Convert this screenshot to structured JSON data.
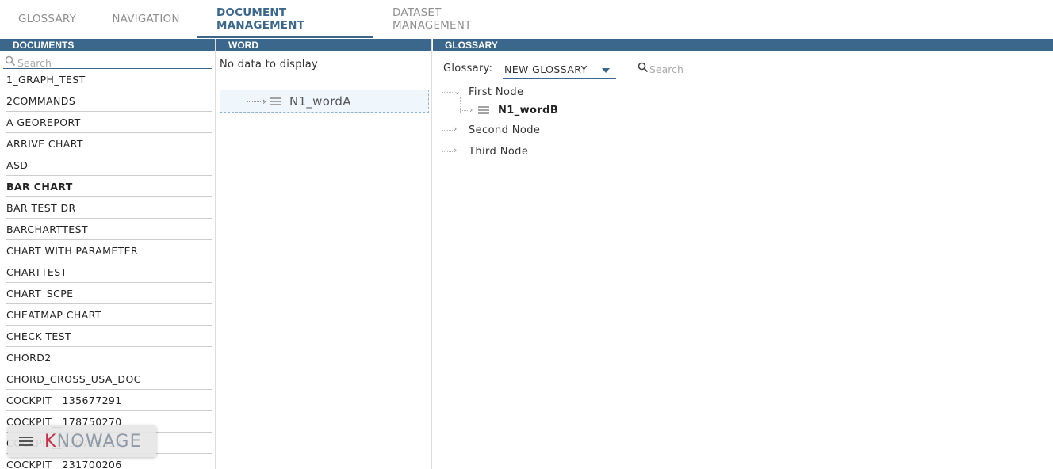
{
  "tabs": [
    {
      "label": "GLOSSARY",
      "active": false
    },
    {
      "label": "NAVIGATION",
      "active": false
    },
    {
      "label": "DOCUMENT MANAGEMENT",
      "active": true
    },
    {
      "label": "DATASET MANAGEMENT",
      "active": false
    }
  ],
  "documents": {
    "header": "DOCUMENTS",
    "search_placeholder": "Search",
    "items": [
      "1_GRAPH_TEST",
      "2COMMANDS",
      "A GEOREPORT",
      "ARRIVE CHART",
      "ASD",
      "BAR CHART",
      "BAR TEST DR",
      "BARCHARTTEST",
      "CHART WITH PARAMETER",
      "CHARTTEST",
      "CHART_SCPE",
      "CHEATMAP CHART",
      "CHECK TEST",
      "CHORD2",
      "CHORD_CROSS_USA_DOC",
      "COCKPIT__135677291",
      "COCKPIT__178750270",
      "COCKPIT__230752357",
      "COCKPIT__231700206"
    ],
    "selected": "BAR CHART"
  },
  "word": {
    "header": "WORD",
    "empty_text": "No data to display",
    "dragged_item": "N1_wordA"
  },
  "glossary": {
    "header": "GLOSSARY",
    "select_label": "Glossary:",
    "selected_glossary": "NEW GLOSSARY",
    "search_placeholder": "Search",
    "tree": {
      "nodes": [
        "First Node",
        "Second Node",
        "Third Node"
      ],
      "child": "N1_wordB"
    }
  },
  "brand": {
    "text": "NOWAGE",
    "k": "K"
  },
  "colors": {
    "accent": "#3b678c",
    "brand_red": "#c6314a"
  }
}
